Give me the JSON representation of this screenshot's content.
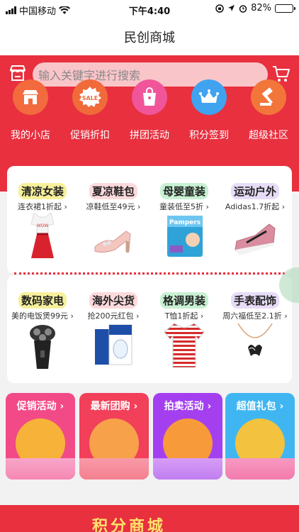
{
  "status": {
    "carrier": "中国移动",
    "time": "下午4:40",
    "battery": "82%",
    "battery_level": 0.82
  },
  "nav": {
    "title": "民创商城"
  },
  "search": {
    "placeholder": "输入关键字进行搜索"
  },
  "categories": [
    {
      "label": "我的小店",
      "icon": "shop-icon",
      "color": "#f26a3e"
    },
    {
      "label": "促销折扣",
      "icon": "sale-tag-icon",
      "color": "#f06a3a"
    },
    {
      "label": "拼团活动",
      "icon": "shopping-bag-icon",
      "color": "#f0559a"
    },
    {
      "label": "积分签到",
      "icon": "crown-icon",
      "color": "#3fa3f0"
    },
    {
      "label": "超级社区",
      "icon": "auction-hammer-icon",
      "color": "#f2763a"
    }
  ],
  "products_row1": [
    {
      "title": "清凉女装",
      "sub": "连衣裙1折起",
      "tag": "#f7f09b",
      "icon": "dress-icon"
    },
    {
      "title": "夏凉鞋包",
      "sub": "凉鞋低至49元",
      "tag": "#fbd9dc",
      "icon": "sandal-icon"
    },
    {
      "title": "母婴童装",
      "sub": "童装低至5折",
      "tag": "#c8f0d2",
      "icon": "diaper-pack-icon"
    },
    {
      "title": "运动户外",
      "sub": "Adidas1.7折起",
      "tag": "#e7dcf7",
      "icon": "sneaker-icon"
    }
  ],
  "products_row2": [
    {
      "title": "数码家电",
      "sub": "美的电饭煲99元",
      "tag": "#f7f09b",
      "icon": "shaver-icon"
    },
    {
      "title": "海外尖货",
      "sub": "抢200元红包",
      "tag": "#fbd9dc",
      "icon": "face-mask-icon"
    },
    {
      "title": "格调男装",
      "sub": "T恤1折起",
      "tag": "#c8f0d2",
      "icon": "tshirt-icon"
    },
    {
      "title": "手表配饰",
      "sub": "周六福低至2.1折",
      "tag": "#e7dcf7",
      "icon": "necklace-icon"
    }
  ],
  "promos": [
    {
      "title": "促销活动",
      "bg": "#f24a86",
      "ring": "#f7b339"
    },
    {
      "title": "最新团购",
      "bg": "#f23f5a",
      "ring": "#f7a24b"
    },
    {
      "title": "拍卖活动",
      "bg": "#a43ff0",
      "ring": "#f79a3a"
    },
    {
      "title": "超值礼包",
      "bg": "#3fb6f2",
      "ring": "#f3c23f"
    }
  ],
  "banner": {
    "text": "积分商城"
  }
}
